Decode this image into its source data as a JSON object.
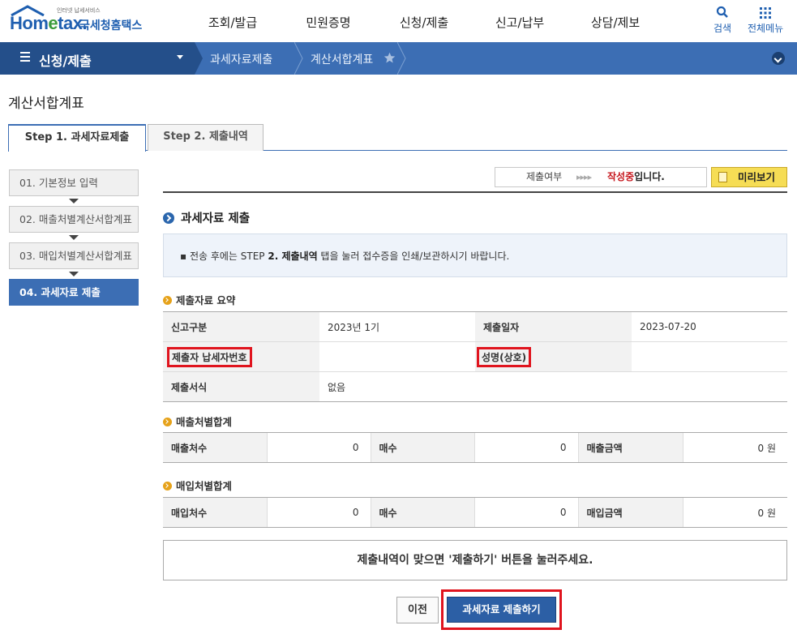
{
  "header": {
    "logo_tagline": "인터넷 납세서비스",
    "logo_main_pre": "Hom",
    "logo_main_e": "e",
    "logo_main_post": "tax.",
    "logo_sub": "국세청홈택스",
    "menu": [
      "조회/발급",
      "민원증명",
      "신청/제출",
      "신고/납부",
      "상담/제보"
    ],
    "search_label": "검색",
    "allmenu_label": "전체메뉴"
  },
  "location": {
    "menu_label": "신청/제출",
    "crumbs": [
      "과세자료제출",
      "계산서합계표"
    ]
  },
  "page": {
    "title": "계산서합계표",
    "tabs": [
      "Step 1. 과세자료제출",
      "Step 2. 제출내역"
    ]
  },
  "steps": [
    "01. 기본정보 입력",
    "02. 매출처별계산서합계표",
    "03. 매입처별계산서합계표",
    "04. 과세자료 제출"
  ],
  "status": {
    "label": "제출여부",
    "arrows": "▸▸▸▸",
    "value_highlight": "작성중",
    "value_suffix": "입니다.",
    "preview_label": "미리보기"
  },
  "section": {
    "title": "과세자료 제출",
    "notice_pre": "▪ 전송 후에는 STEP ",
    "notice_bold": "2. 제출내역",
    "notice_post": " 탭을 눌러 접수증을 인쇄/보관하시기 바랍니다."
  },
  "summary": {
    "title": "제출자료 요약",
    "report_type_label": "신고구분",
    "report_type_value": "2023년 1기",
    "submit_date_label": "제출일자",
    "submit_date_value": "2023-07-20",
    "submitter_tin_label": "제출자 납세자번호",
    "submitter_tin_value": "",
    "name_label": "성명(상호)",
    "name_value": "",
    "form_label": "제출서식",
    "form_value": "없음"
  },
  "sales": {
    "title": "매출처별합계",
    "count_label": "매출처수",
    "count_value": "0",
    "sheets_label": "매수",
    "sheets_value": "0",
    "amount_label": "매출금액",
    "amount_value": "0 원"
  },
  "purchase": {
    "title": "매입처별합계",
    "count_label": "매입처수",
    "count_value": "0",
    "sheets_label": "매수",
    "sheets_value": "0",
    "amount_label": "매입금액",
    "amount_value": "0 원"
  },
  "confirm_text": "제출내역이 맞으면 '제출하기' 버튼을 눌러주세요.",
  "buttons": {
    "prev": "이전",
    "submit": "과세자료 제출하기"
  },
  "colors": {
    "brand_blue": "#3c6eb4",
    "nav_dark": "#244f8a",
    "highlight_red": "#e0141e",
    "status_red": "#c6161d",
    "preview_yellow": "#f6dd55"
  }
}
